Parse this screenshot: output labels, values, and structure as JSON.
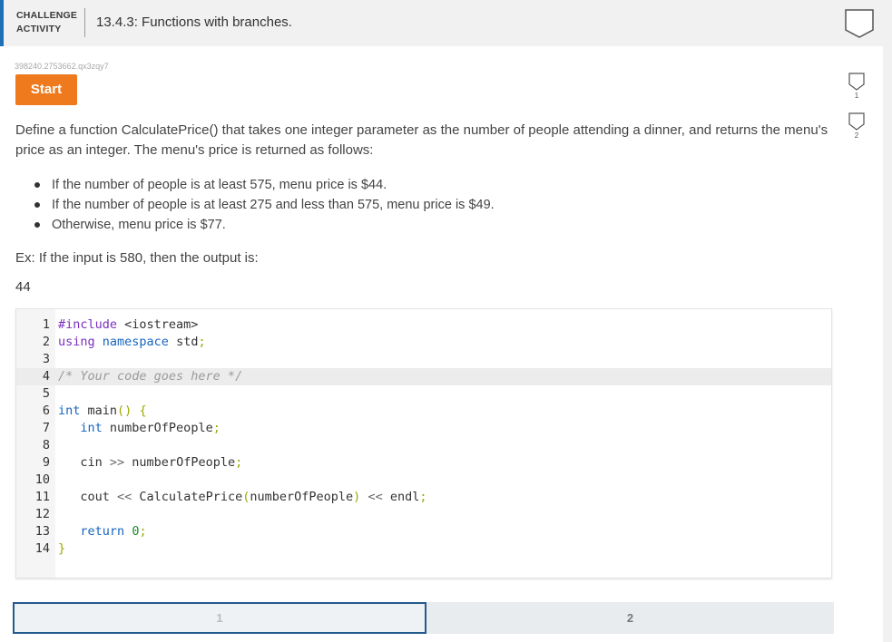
{
  "header": {
    "activity_type_line1": "CHALLENGE",
    "activity_type_line2": "ACTIVITY",
    "title": "13.4.3: Functions with branches."
  },
  "activity_id": "398240.2753662.qx3zqy7",
  "start_button": "Start",
  "levels": [
    {
      "label": "1"
    },
    {
      "label": "2"
    }
  ],
  "prompt": {
    "text": "Define a function CalculatePrice() that takes one integer parameter as the number of people attending a dinner, and returns the menu's price as an integer. The menu's price is returned as follows:",
    "bullets": [
      "If the number of people is at least 575, menu price is $44.",
      "If the number of people is at least 275 and less than 575, menu price is $49.",
      "Otherwise, menu price is $77."
    ],
    "example": "Ex: If the input is 580, then the output is:",
    "output": "44"
  },
  "editor": {
    "active_line": 4,
    "lines": [
      {
        "num": "1",
        "tokens": [
          {
            "t": "#include",
            "c": "k"
          },
          {
            "t": " <iostream>",
            "c": ""
          }
        ]
      },
      {
        "num": "2",
        "tokens": [
          {
            "t": "using",
            "c": "k"
          },
          {
            "t": " ",
            "c": ""
          },
          {
            "t": "namespace",
            "c": "t"
          },
          {
            "t": " std",
            "c": ""
          },
          {
            "t": ";",
            "c": "p"
          }
        ]
      },
      {
        "num": "3",
        "tokens": []
      },
      {
        "num": "4",
        "tokens": [
          {
            "t": "/* Your code goes here */",
            "c": "c"
          }
        ]
      },
      {
        "num": "5",
        "tokens": []
      },
      {
        "num": "6",
        "tokens": [
          {
            "t": "int",
            "c": "t"
          },
          {
            "t": " main",
            "c": ""
          },
          {
            "t": "()",
            "c": "p"
          },
          {
            "t": " ",
            "c": ""
          },
          {
            "t": "{",
            "c": "p"
          }
        ]
      },
      {
        "num": "7",
        "tokens": [
          {
            "t": "   ",
            "c": ""
          },
          {
            "t": "int",
            "c": "t"
          },
          {
            "t": " numberOfPeople",
            "c": ""
          },
          {
            "t": ";",
            "c": "p"
          }
        ]
      },
      {
        "num": "8",
        "tokens": []
      },
      {
        "num": "9",
        "tokens": [
          {
            "t": "   cin ",
            "c": ""
          },
          {
            "t": ">>",
            "c": "o"
          },
          {
            "t": " numberOfPeople",
            "c": ""
          },
          {
            "t": ";",
            "c": "p"
          }
        ]
      },
      {
        "num": "10",
        "tokens": []
      },
      {
        "num": "11",
        "tokens": [
          {
            "t": "   cout ",
            "c": ""
          },
          {
            "t": "<<",
            "c": "o"
          },
          {
            "t": " CalculatePrice",
            "c": ""
          },
          {
            "t": "(",
            "c": "p"
          },
          {
            "t": "numberOfPeople",
            "c": ""
          },
          {
            "t": ")",
            "c": "p"
          },
          {
            "t": " ",
            "c": ""
          },
          {
            "t": "<<",
            "c": "o"
          },
          {
            "t": " endl",
            "c": ""
          },
          {
            "t": ";",
            "c": "p"
          }
        ]
      },
      {
        "num": "12",
        "tokens": []
      },
      {
        "num": "13",
        "tokens": [
          {
            "t": "   ",
            "c": ""
          },
          {
            "t": "return",
            "c": "t"
          },
          {
            "t": " ",
            "c": ""
          },
          {
            "t": "0",
            "c": "n"
          },
          {
            "t": ";",
            "c": "p"
          }
        ]
      },
      {
        "num": "14",
        "tokens": [
          {
            "t": "}",
            "c": "p"
          }
        ]
      }
    ]
  },
  "progress": {
    "current": 1,
    "segments": [
      {
        "label": "1"
      },
      {
        "label": "2"
      }
    ]
  },
  "colors": {
    "accent": "#1f6fb4",
    "start_button": "#ef7a1e",
    "current_level_border": "#245a8d"
  },
  "icons": {
    "header": "shield-icon",
    "level": "level-shield-icon"
  }
}
